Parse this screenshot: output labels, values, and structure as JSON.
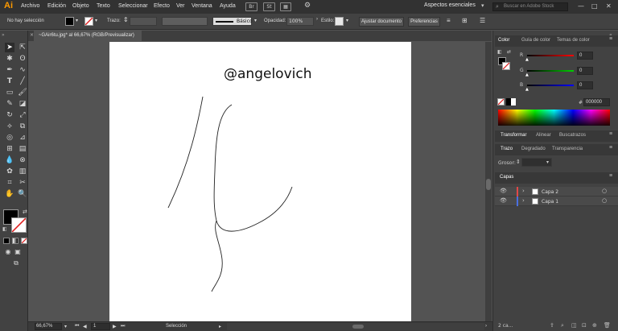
{
  "app": {
    "logo": "Ai",
    "menu": [
      "Archivo",
      "Edición",
      "Objeto",
      "Texto",
      "Seleccionar",
      "Efecto",
      "Ver",
      "Ventana",
      "Ayuda"
    ],
    "workspace": "Aspectos esenciales",
    "stock_search_placeholder": "Buscar en Adobe Stock",
    "bridge_label": "Br",
    "stock_label": "St"
  },
  "control_bar": {
    "selection_status": "No hay selección",
    "stroke_label": "Trazo:",
    "brush_label": "Básico",
    "opacity_label": "Opacidad:",
    "opacity_value": "100%",
    "style_label": "Estilo:",
    "adjust_document_button": "Ajustar documento",
    "preferences_button": "Preferencias"
  },
  "document": {
    "tab_title": "~GAir6tu.jpg* al 66,67% (RGB/Previsualizar)",
    "artboard_text": "@angelovich"
  },
  "color_panel": {
    "tabs": [
      "Color",
      "Guía de color",
      "Temas de color"
    ],
    "channels": [
      {
        "label": "R",
        "value": "0"
      },
      {
        "label": "G",
        "value": "0"
      },
      {
        "label": "B",
        "value": "0"
      }
    ],
    "hex_label": "#",
    "hex_value": "000000"
  },
  "transform_panel": {
    "tabs": [
      "Transformar",
      "Alinear",
      "Buscatrazos"
    ]
  },
  "stroke_panel": {
    "tabs": [
      "Trazo",
      "Degradado",
      "Transparencia"
    ],
    "weight_label": "Grosor:"
  },
  "layers_panel": {
    "title": "Capas",
    "layers": [
      {
        "name": "Capa 2",
        "color": "#e04848"
      },
      {
        "name": "Capa 1",
        "color": "#4a6fe0"
      }
    ],
    "footer": "2 ca..."
  },
  "status_bar": {
    "zoom": "66,67%",
    "artboard_number": "1",
    "tool_name": "Selección"
  }
}
